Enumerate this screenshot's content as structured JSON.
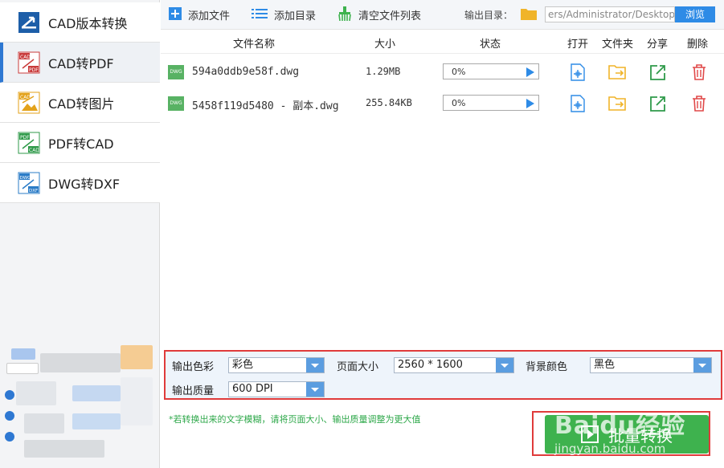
{
  "sidebar": {
    "items": [
      {
        "label": "CAD版本转换",
        "icon": "cad-version-icon",
        "active": false
      },
      {
        "label": "CAD转PDF",
        "icon": "cad-to-pdf-icon",
        "active": true
      },
      {
        "label": "CAD转图片",
        "icon": "cad-to-image-icon",
        "active": false
      },
      {
        "label": "PDF转CAD",
        "icon": "pdf-to-cad-icon",
        "active": false
      },
      {
        "label": "DWG转DXF",
        "icon": "dwg-to-dxf-icon",
        "active": false
      }
    ],
    "icon_tags": {
      "cad1": "CAD",
      "pdf": "PDF",
      "cad2": "CAD",
      "pdf2": "PDF",
      "cad3": "CAD",
      "dwg": "DWG",
      "dxf": "DXF"
    }
  },
  "toolbar": {
    "add_file": "添加文件",
    "add_folder": "添加目录",
    "clear_list": "清空文件列表",
    "output_label": "输出目录：",
    "output_path": "ers/Administrator/Desktop",
    "browse": "浏览"
  },
  "table": {
    "headers": {
      "name": "文件名称",
      "size": "大小",
      "status": "状态",
      "open": "打开",
      "folder": "文件夹",
      "share": "分享",
      "delete": "删除"
    },
    "rows": [
      {
        "name": "594a0ddb9e58f.dwg",
        "size": "1.29MB",
        "progress": "0%",
        "type": "DWG"
      },
      {
        "name": "5458f119d5480 - 副本.dwg",
        "size": "255.84KB",
        "progress": "0%",
        "type": "DWG"
      }
    ]
  },
  "options": {
    "color_label": "输出色彩",
    "color_value": "彩色",
    "page_size_label": "页面大小",
    "page_size_value": "2560 * 1600",
    "bg_color_label": "背景颜色",
    "bg_color_value": "黑色",
    "quality_label": "输出质量",
    "quality_value": "600 DPI"
  },
  "tip": "*若转换出来的文字模糊，请将页面大小、输出质量调整为更大值",
  "convert_button": "批量转换",
  "watermark": {
    "main": "Baidu经验",
    "sub": "jingyan.baidu.com"
  },
  "colors": {
    "accent": "#2e8be6",
    "green": "#3eb24e",
    "highlight": "#e03b3b",
    "folder": "#f0b429",
    "delete": "#e04848"
  }
}
